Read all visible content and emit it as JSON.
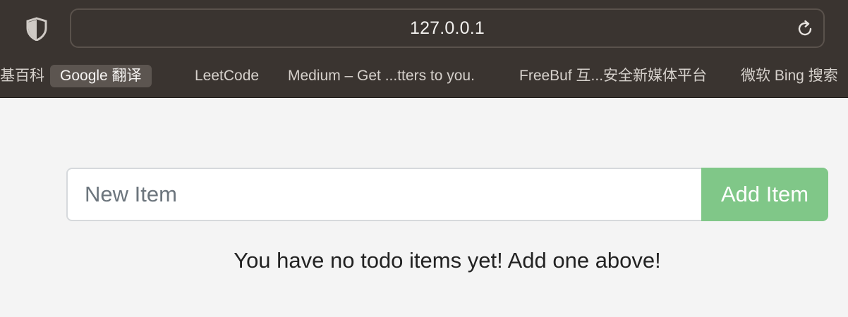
{
  "browser": {
    "url": "127.0.0.1",
    "bookmarks": [
      {
        "label": "基百科"
      },
      {
        "label": "Google 翻译"
      },
      {
        "label": "LeetCode"
      },
      {
        "label": "Medium – Get ...tters to you."
      },
      {
        "label": "FreeBuf 互...安全新媒体平台"
      },
      {
        "label": "微软 Bing 搜索"
      }
    ],
    "active_bookmark_index": 1,
    "shield_icon": "shield-icon",
    "reload_icon": "reload-icon"
  },
  "todo": {
    "input_placeholder": "New Item",
    "input_value": "",
    "add_button_label": "Add Item",
    "empty_message": "You have no todo items yet! Add one above!"
  },
  "colors": {
    "chrome_bg": "#3a3430",
    "page_bg": "#f4f4f4",
    "add_button_bg": "#80c788",
    "placeholder": "#6c757d"
  }
}
